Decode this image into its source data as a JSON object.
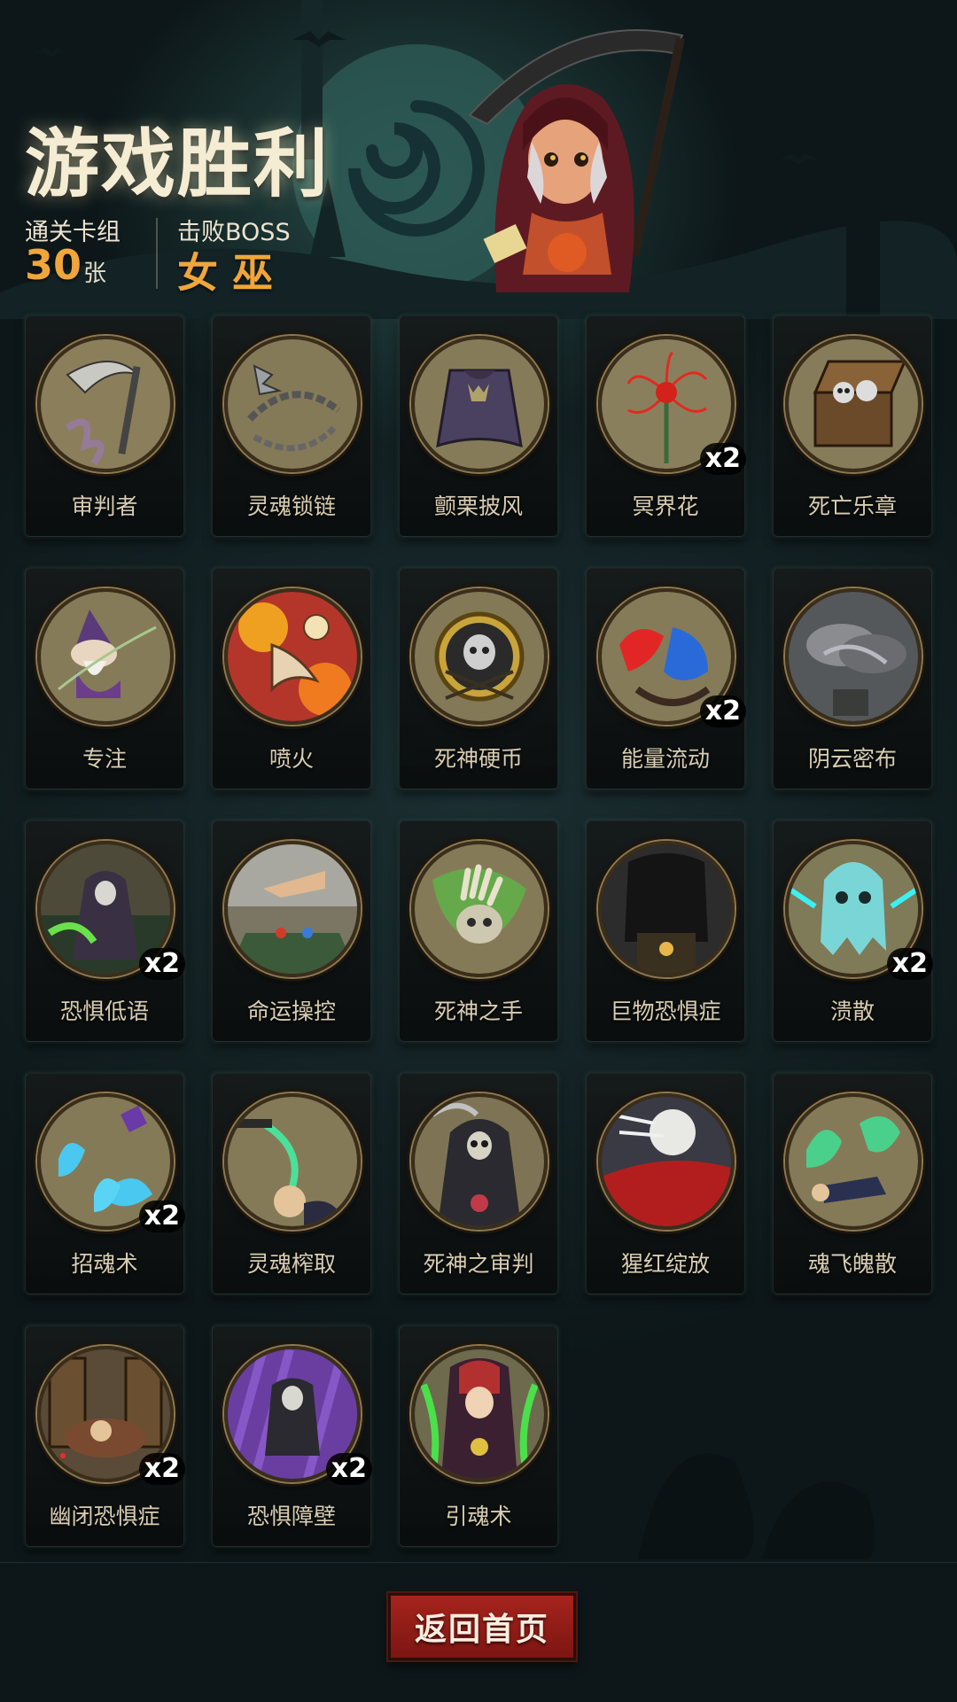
{
  "header": {
    "title": "游戏胜利",
    "deck_label": "通关卡组",
    "deck_count": "30",
    "deck_unit": "张",
    "boss_label": "击败BOSS",
    "boss_name": "女 巫"
  },
  "cards": [
    {
      "name": "审判者",
      "count": "",
      "art": "scythe-icon",
      "bg": "#8b7e5a"
    },
    {
      "name": "灵魂锁链",
      "count": "",
      "art": "chain-icon",
      "bg": "#857a57"
    },
    {
      "name": "颤栗披风",
      "count": "",
      "art": "cloak-icon",
      "bg": "#867b58"
    },
    {
      "name": "冥界花",
      "count": "x2",
      "art": "spider-lily-icon",
      "bg": "#8a7f5c"
    },
    {
      "name": "死亡乐章",
      "count": "",
      "art": "music-box-icon",
      "bg": "#877c59"
    },
    {
      "name": "专注",
      "count": "",
      "art": "wizard-icon",
      "bg": "#867b58"
    },
    {
      "name": "喷火",
      "count": "",
      "art": "fire-breath-icon",
      "bg": "#b4362a"
    },
    {
      "name": "死神硬币",
      "count": "",
      "art": "skull-coin-icon",
      "bg": "#847956"
    },
    {
      "name": "能量流动",
      "count": "x2",
      "art": "energy-flow-icon",
      "bg": "#867b58"
    },
    {
      "name": "阴云密布",
      "count": "",
      "art": "storm-cloud-icon",
      "bg": "#55585a"
    },
    {
      "name": "恐惧低语",
      "count": "x2",
      "art": "reaper-whisper-icon",
      "bg": "#4d4a3a"
    },
    {
      "name": "命运操控",
      "count": "",
      "art": "puppet-hand-icon",
      "bg": "#7a7663"
    },
    {
      "name": "死神之手",
      "count": "",
      "art": "skeleton-hand-icon",
      "bg": "#857a57"
    },
    {
      "name": "巨物恐惧症",
      "count": "",
      "art": "giant-shadow-icon",
      "bg": "#2c2c2c"
    },
    {
      "name": "溃散",
      "count": "x2",
      "art": "ghost-icon",
      "bg": "#7f7a58"
    },
    {
      "name": "招魂术",
      "count": "x2",
      "art": "blue-flame-icon",
      "bg": "#857a57"
    },
    {
      "name": "灵魂榨取",
      "count": "",
      "art": "soul-drain-icon",
      "bg": "#857a57"
    },
    {
      "name": "死神之审判",
      "count": "",
      "art": "reaper-icon",
      "bg": "#7e7455"
    },
    {
      "name": "猩红绽放",
      "count": "",
      "art": "red-moon-field-icon",
      "bg": "#3a3a42"
    },
    {
      "name": "魂飞魄散",
      "count": "",
      "art": "green-spirit-icon",
      "bg": "#857a57"
    },
    {
      "name": "幽闭恐惧症",
      "count": "x2",
      "art": "closet-icon",
      "bg": "#5a4a38"
    },
    {
      "name": "恐惧障壁",
      "count": "x2",
      "art": "purple-barrier-icon",
      "bg": "#6a3ea0"
    },
    {
      "name": "引魂术",
      "count": "",
      "art": "soul-guide-icon",
      "bg": "#6d6a4e"
    }
  ],
  "footer": {
    "home_label": "返回首页"
  }
}
